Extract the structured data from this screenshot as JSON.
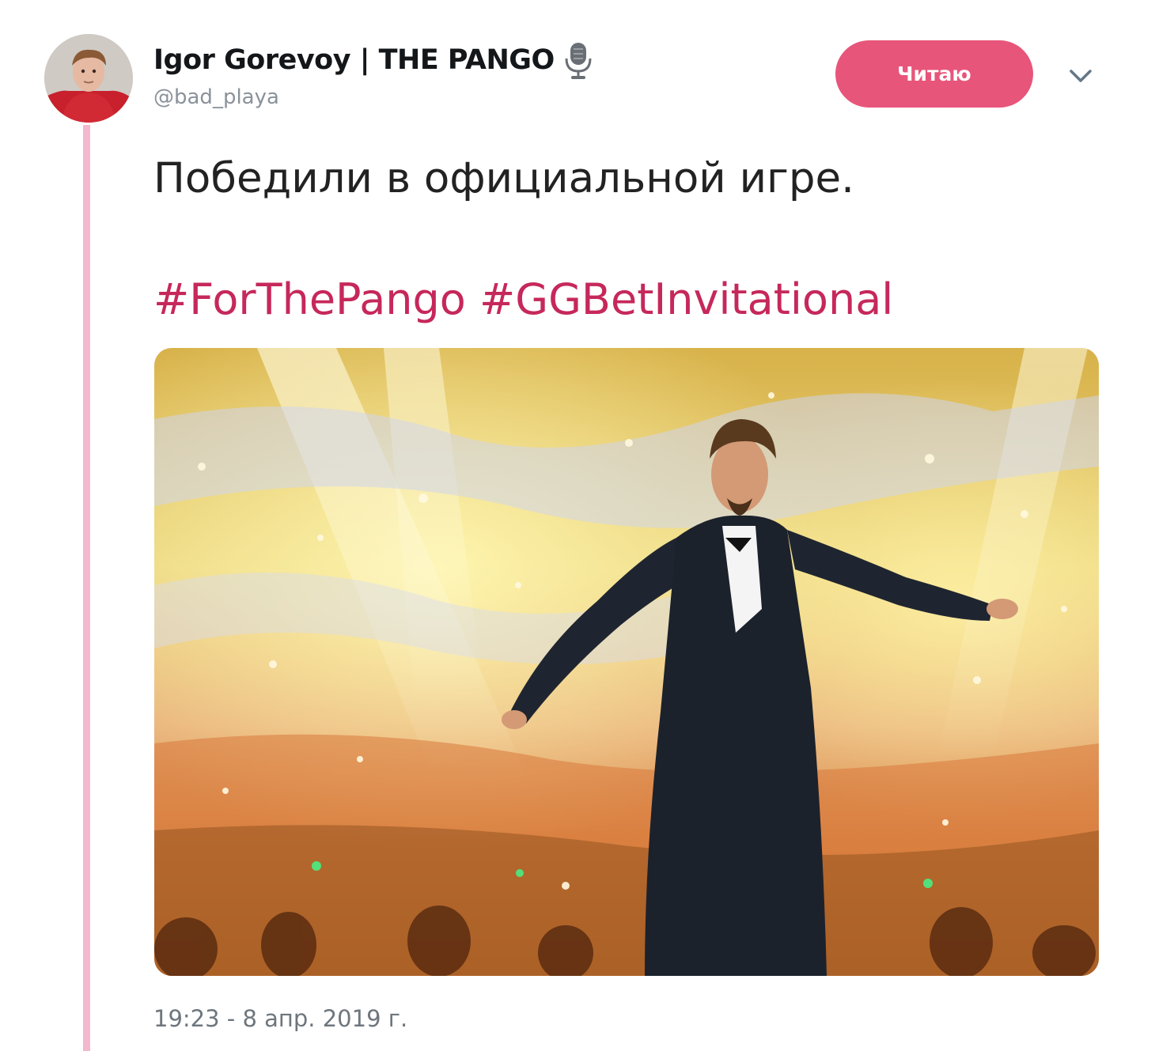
{
  "author": {
    "name": "Igor Gorevoy | THE PANGO",
    "handle": "@bad_playa",
    "badge_icon": "microphone-icon"
  },
  "follow_button": {
    "label": "Читаю",
    "color": "#e8557a"
  },
  "menu_icon": "chevron-down-icon",
  "tweet": {
    "text": "Победили в официальной игре.",
    "hashtags": [
      "#ForThePango",
      "#GGBetInvitational"
    ],
    "hashtag_color": "#c6285b",
    "timestamp": "19:23 - 8 апр. 2019 г."
  },
  "thread_line_color": "#f3b8cd"
}
